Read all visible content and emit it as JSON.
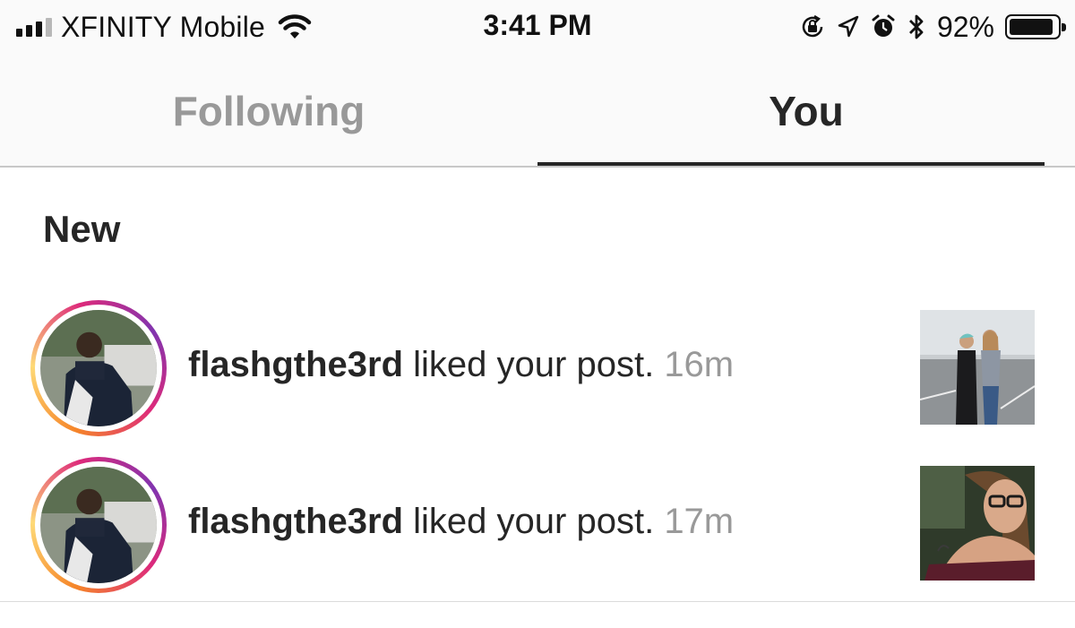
{
  "status_bar": {
    "carrier": "XFINITY Mobile",
    "time": "3:41 PM",
    "battery_percent": "92%",
    "battery_level": 0.92,
    "icons": [
      "signal-bars-icon",
      "wifi-icon",
      "orientation-lock-icon",
      "location-arrow-icon",
      "alarm-clock-icon",
      "bluetooth-icon",
      "battery-icon"
    ]
  },
  "tabs": [
    {
      "label": "Following",
      "selected": false
    },
    {
      "label": "You",
      "selected": true
    }
  ],
  "section": {
    "title": "New"
  },
  "notifications": [
    {
      "username": "flashgthe3rd",
      "action": " liked your post.",
      "time": "16m",
      "avatar": "profile-photo",
      "thumbnail": "two-women-parking-lot-photo"
    },
    {
      "username": "flashgthe3rd",
      "action": " liked your post.",
      "time": "17m",
      "avatar": "profile-photo",
      "thumbnail": "woman-with-glasses-selfie-photo"
    }
  ],
  "colors": {
    "text_primary": "#262626",
    "text_secondary": "#999999",
    "story_ring": [
      "#f58529",
      "#dd2a7b",
      "#8134af"
    ],
    "header_bg": "#fafafa"
  }
}
